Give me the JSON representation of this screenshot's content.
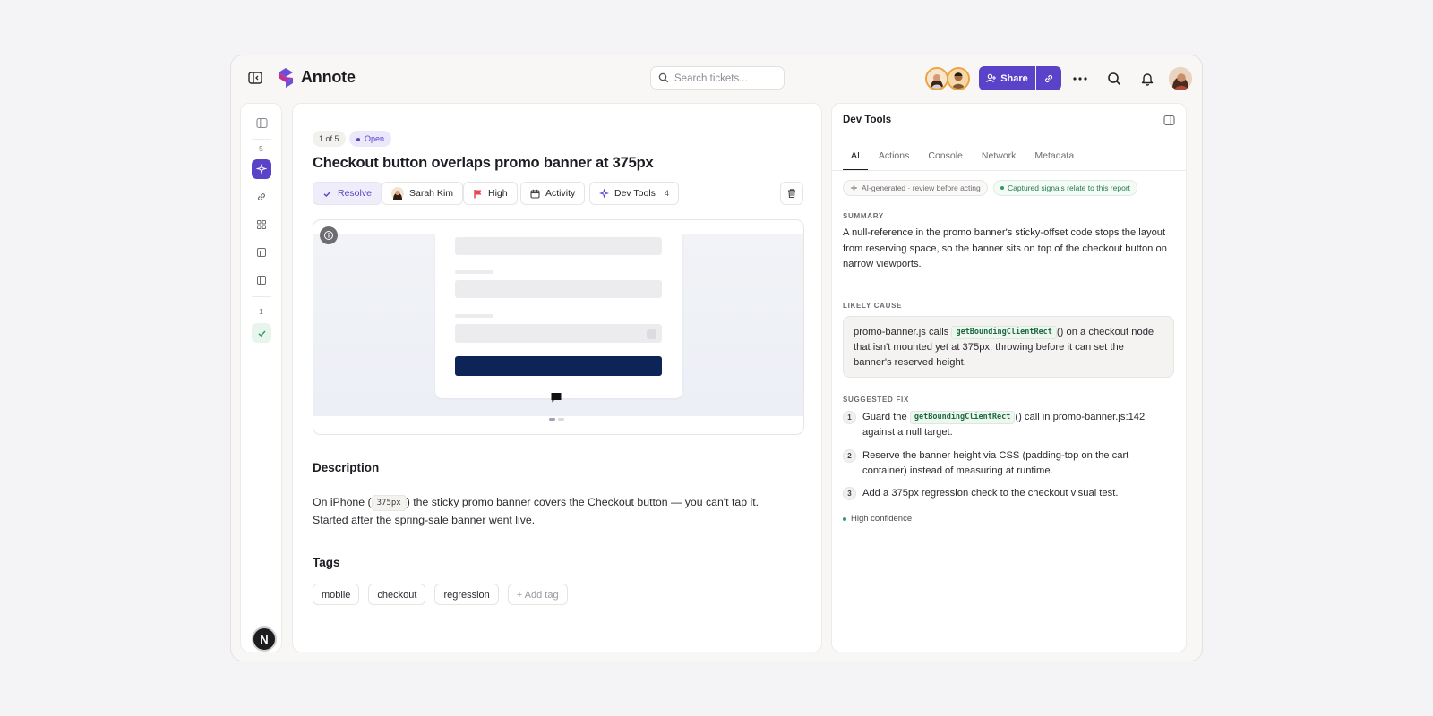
{
  "app": {
    "brand": "Annote"
  },
  "search": {
    "placeholder": "Search tickets..."
  },
  "header": {
    "share_label": "Share"
  },
  "rail": {
    "count_top": "5",
    "count_bottom": "1"
  },
  "ticket": {
    "counter": "1 of 5",
    "status": "Open",
    "title": "Checkout button overlaps promo banner at 375px",
    "actions": {
      "resolve": "Resolve",
      "assignee": "Sarah Kim",
      "priority": "High",
      "activity": "Activity",
      "devtools": "Dev Tools",
      "devtools_count": "4"
    },
    "description_heading": "Description",
    "description_before": "On iPhone (",
    "description_code": "375px",
    "description_after": ") the sticky promo banner covers the Checkout button — you can't tap it. Started after the spring-sale banner went live.",
    "tags_heading": "Tags",
    "tags": [
      "mobile",
      "checkout",
      "regression"
    ],
    "add_tag": "+ Add tag"
  },
  "panel": {
    "title": "Dev Tools",
    "tabs": [
      "AI",
      "Actions",
      "Console",
      "Network",
      "Metadata"
    ],
    "active_tab": "AI",
    "disclaimer": "AI-generated · review before acting",
    "signals": "Captured signals relate to this report",
    "summary_label": "SUMMARY",
    "summary": "A null-reference in the promo banner's sticky-offset code stops the layout from reserving space, so the banner sits on top of the checkout button on narrow viewports.",
    "cause_label": "LIKELY CAUSE",
    "cause_before": "promo-banner.js calls ",
    "cause_code": "getBoundingClientRect",
    "cause_after": "() on a checkout node that isn't mounted yet at 375px, throwing before it can set the banner's reserved height.",
    "fix_label": "SUGGESTED FIX",
    "fixes": [
      {
        "n": "1",
        "before": "Guard the ",
        "code": "getBoundingClientRect",
        "after": "() call in promo-banner.js:142 against a null target."
      },
      {
        "n": "2",
        "text": "Reserve the banner height via CSS (padding-top on the cart container) instead of measuring at runtime."
      },
      {
        "n": "3",
        "text": "Add a 375px regression check to the checkout visual test."
      }
    ],
    "confidence": "High confidence"
  },
  "colors": {
    "accent": "#5a43c9",
    "cta": "#0f2456",
    "success": "#2f9c60"
  },
  "icons": [
    "sidebar-toggle-icon",
    "search-icon",
    "user-plus-icon",
    "link-icon",
    "more-icon",
    "bell-icon",
    "check-icon",
    "flag-icon",
    "calendar-icon",
    "sparkle-icon",
    "trash-icon",
    "info-icon",
    "comment-icon",
    "panel-icon"
  ]
}
